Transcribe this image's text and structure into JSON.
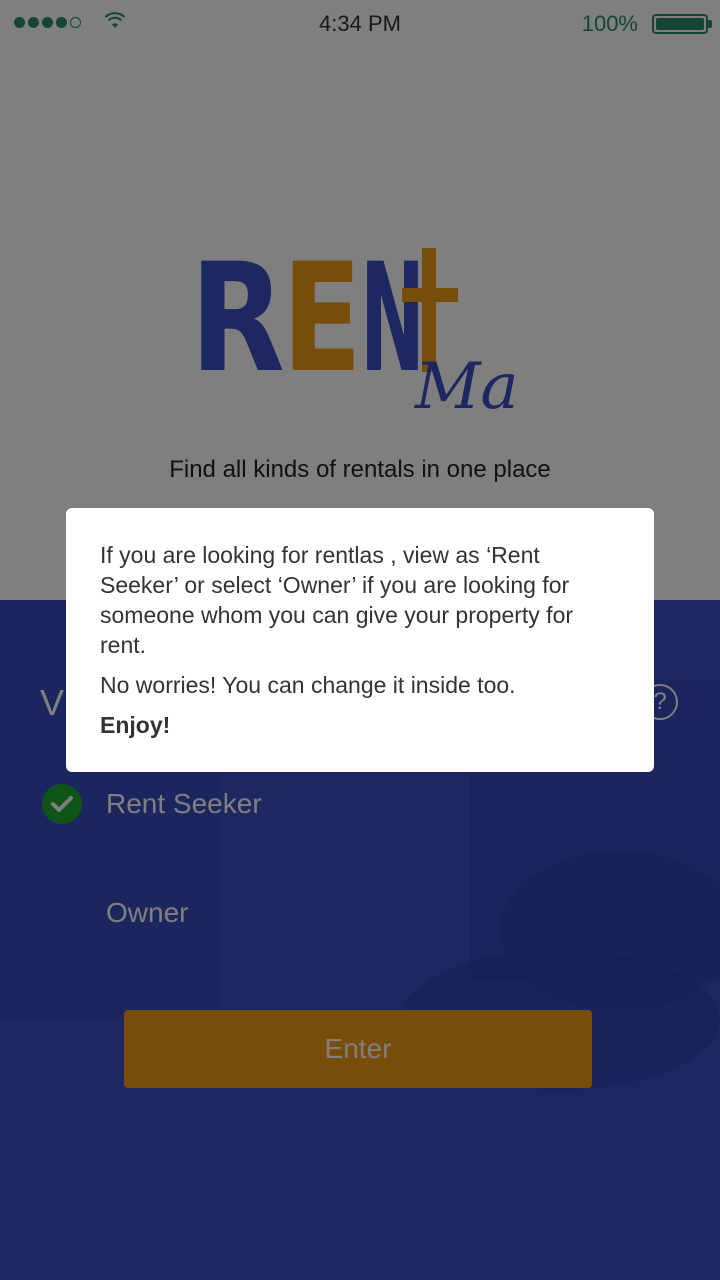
{
  "status_bar": {
    "time": "4:34 PM",
    "battery_percent": "100%",
    "battery_level": 1.0,
    "signal_bars": 4,
    "signal_max": 5,
    "status_color": "#2a8a6f"
  },
  "logo": {
    "text": "RENT",
    "script": "Ma",
    "primary_color": "#3a50c4",
    "accent_color": "#f09a12"
  },
  "tagline": "Find all kinds of rentals in one place",
  "view_heading": "V",
  "options": [
    {
      "label": "Rent Seeker",
      "selected": true
    },
    {
      "label": "Owner",
      "selected": false
    }
  ],
  "enter_button": {
    "label": "Enter",
    "color": "#f09a12"
  },
  "dialog": {
    "paragraph1": "If you are looking for rentlas , view as ‘Rent Seeker’ or select ‘Owner’ if you are looking for someone whom you can give your property for rent.",
    "paragraph2": "No worries! You can change it inside too.",
    "paragraph3": "Enjoy!"
  },
  "icons": {
    "help": "help-circle-icon",
    "check": "check-icon",
    "wifi": "wifi-icon"
  }
}
